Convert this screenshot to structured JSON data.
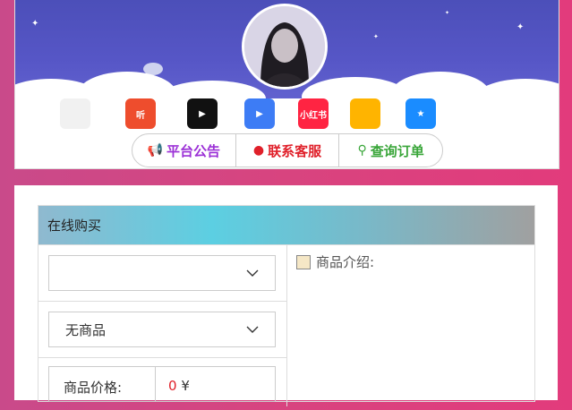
{
  "apps": [
    {
      "name": "music-app-icon",
      "bg": "#f1f1f1",
      "label": ""
    },
    {
      "name": "listen-app-icon",
      "bg": "#ee4d2d",
      "label": "听"
    },
    {
      "name": "video-play-app-icon",
      "bg": "#111111",
      "label": "▶"
    },
    {
      "name": "video-app-icon",
      "bg": "#3d7cf5",
      "label": "▶"
    },
    {
      "name": "xiaohongshu-app-icon",
      "bg": "#ff2442",
      "label": "小红书"
    },
    {
      "name": "game-app-icon",
      "bg": "#ffb400",
      "label": ""
    },
    {
      "name": "qzone-app-icon",
      "bg": "#1a8cff",
      "label": "★"
    },
    {
      "name": "qq-app-icon",
      "bg": "#ffffff",
      "label": ""
    }
  ],
  "nav": {
    "announcement": "平台公告",
    "support": "联系客服",
    "query": "查询订单"
  },
  "colors": {
    "announcement": "#9b30d6",
    "support": "#e0202a",
    "query": "#3aa63a"
  },
  "panel": {
    "title": "在线购买"
  },
  "form": {
    "category_value": "",
    "product_value": "无商品",
    "price_label": "商品价格:",
    "price_value": "0",
    "currency": "¥"
  },
  "intro": {
    "label": "商品介绍:"
  }
}
